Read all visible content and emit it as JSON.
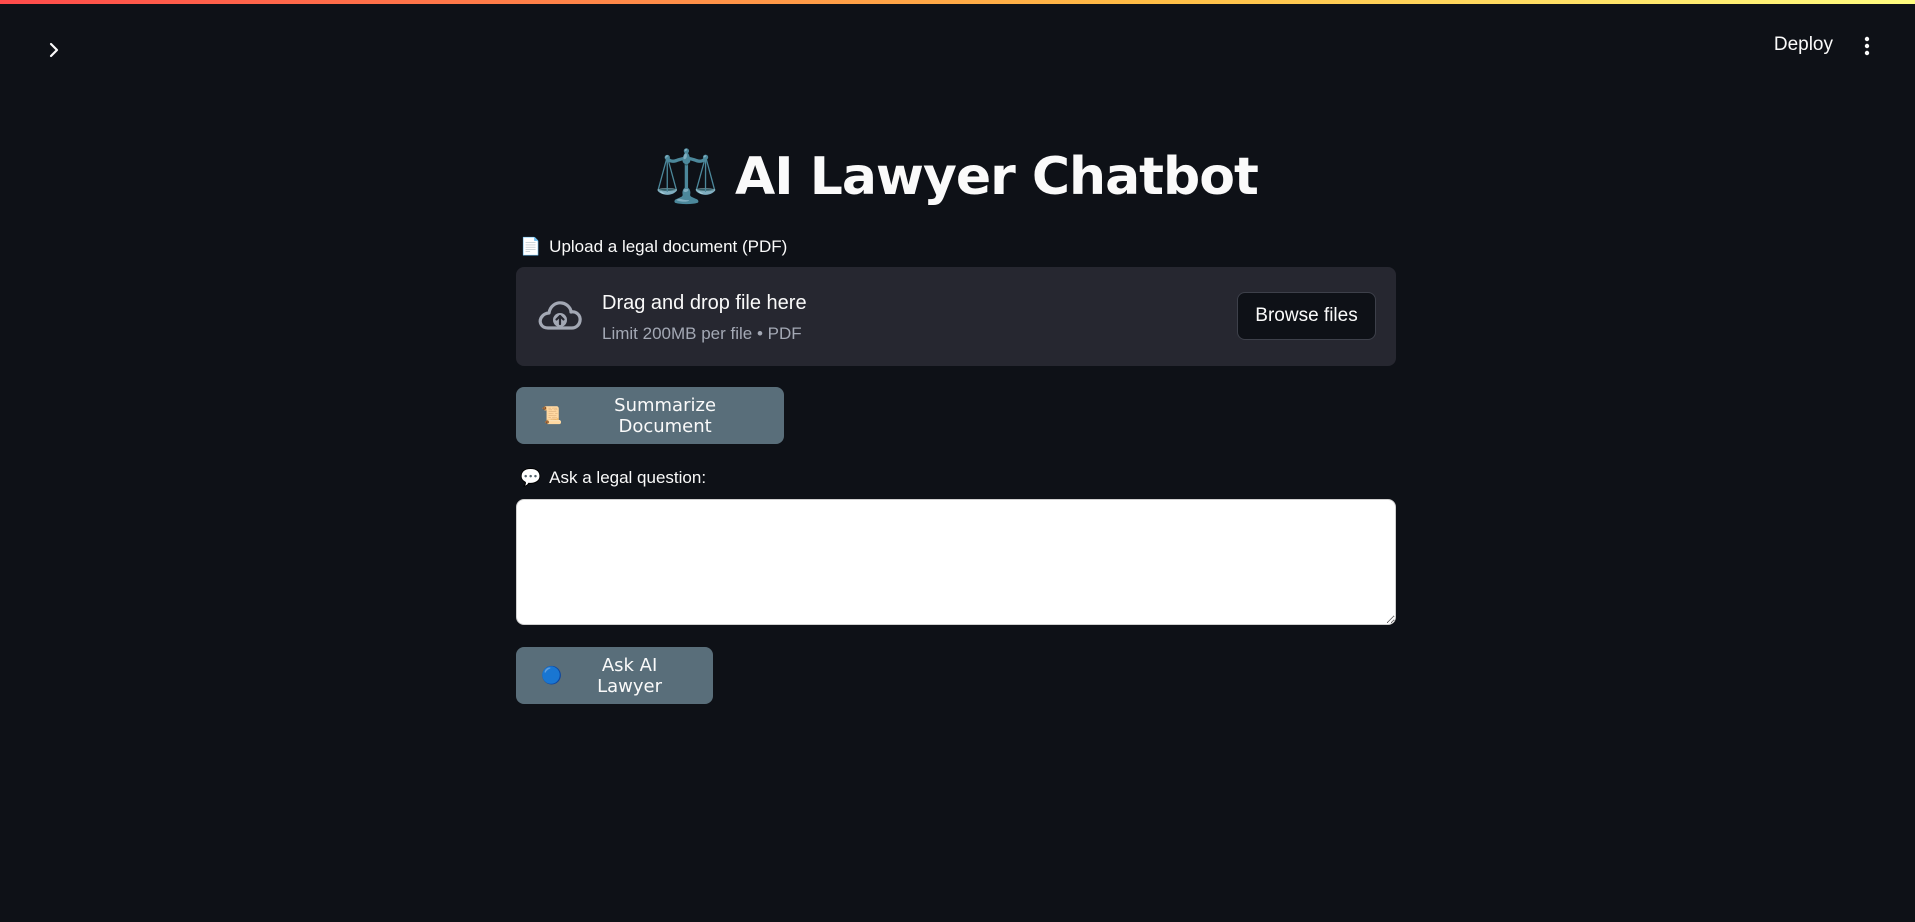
{
  "header": {
    "deploy_label": "Deploy",
    "sidebar_toggle_icon": "chevron-right-icon",
    "menu_icon": "vertical-dots-icon"
  },
  "main": {
    "title_icon": "⚖️",
    "title": "AI Lawyer Chatbot",
    "upload": {
      "label_icon": "📄",
      "label": "Upload a legal document (PDF)",
      "drop_title": "Drag and drop file here",
      "drop_limit": "Limit 200MB per file • PDF",
      "browse_label": "Browse files",
      "icon": "cloud-upload-icon"
    },
    "summarize": {
      "icon": "📜",
      "label": "Summarize Document"
    },
    "question": {
      "label_icon": "💬",
      "label": "Ask a legal question:",
      "value": "",
      "placeholder": ""
    },
    "ask": {
      "icon": "🔵",
      "label": "Ask AI Lawyer"
    }
  },
  "colors": {
    "background": "#0e1117",
    "uploader_bg": "#262730",
    "button_bg": "#596e7a",
    "accent_gradient_start": "#ff4b4b",
    "accent_gradient_end": "#fffd80"
  }
}
